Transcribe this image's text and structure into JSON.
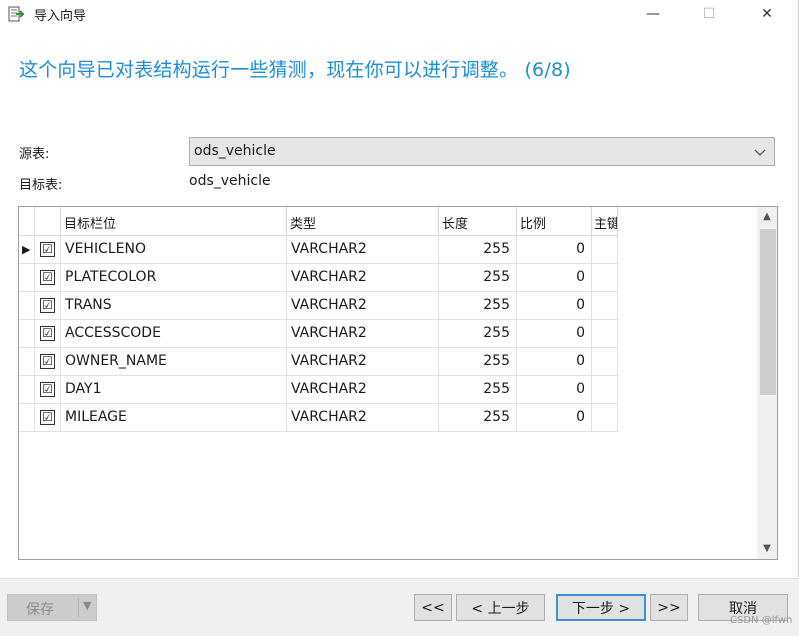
{
  "window": {
    "title": "导入向导",
    "minimize": "—",
    "maximize": "☐",
    "close": "✕"
  },
  "heading": "这个向导已对表结构运行一些猜测，现在你可以进行调整。 (6/8)",
  "source": {
    "label": "源表:",
    "value": "ods_vehicle"
  },
  "target": {
    "label": "目标表:",
    "value": "ods_vehicle"
  },
  "grid": {
    "columns": [
      "目标栏位",
      "类型",
      "长度",
      "比例",
      "主键"
    ],
    "rows": [
      {
        "indicator": "▶",
        "checked": "☑",
        "field": "VEHICLENO",
        "type": "VARCHAR2",
        "length": "255",
        "scale": "0"
      },
      {
        "indicator": "",
        "checked": "☑",
        "field": "PLATECOLOR",
        "type": "VARCHAR2",
        "length": "255",
        "scale": "0"
      },
      {
        "indicator": "",
        "checked": "☑",
        "field": "TRANS",
        "type": "VARCHAR2",
        "length": "255",
        "scale": "0"
      },
      {
        "indicator": "",
        "checked": "☑",
        "field": "ACCESSCODE",
        "type": "VARCHAR2",
        "length": "255",
        "scale": "0"
      },
      {
        "indicator": "",
        "checked": "☑",
        "field": "OWNER_NAME",
        "type": "VARCHAR2",
        "length": "255",
        "scale": "0"
      },
      {
        "indicator": "",
        "checked": "☑",
        "field": "DAY1",
        "type": "VARCHAR2",
        "length": "255",
        "scale": "0"
      },
      {
        "indicator": "",
        "checked": "☑",
        "field": "MILEAGE",
        "type": "VARCHAR2",
        "length": "255",
        "scale": "0"
      }
    ]
  },
  "footer": {
    "save": "保存",
    "first": "<<",
    "prev": "< 上一步",
    "next": "下一步 >",
    "last": ">>",
    "cancel": "取消"
  },
  "watermark": "CSDN @lfwh",
  "colors": {
    "heading": "#1a8fd8",
    "default_button_border": "#3c8fd8"
  }
}
